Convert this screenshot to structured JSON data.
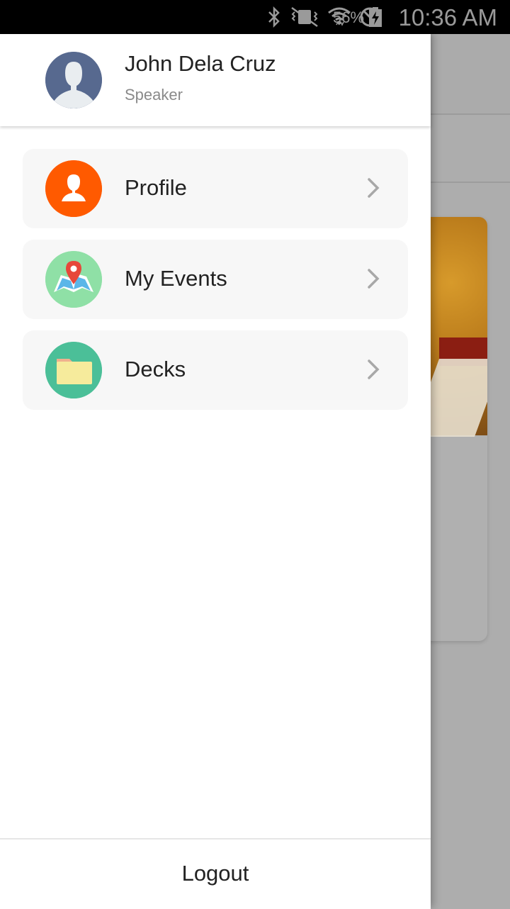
{
  "status_bar": {
    "battery_percent": "56%",
    "time": "10:36 AM",
    "icons": [
      "bluetooth-icon",
      "vibrate-icon",
      "wifi-icon",
      "do-not-disturb-icon",
      "battery-charging-icon"
    ]
  },
  "drawer": {
    "user": {
      "name": "John Dela Cruz",
      "role": "Speaker"
    },
    "items": [
      {
        "label": "Profile",
        "icon": "person-icon",
        "icon_bg": "#FF5A00"
      },
      {
        "label": "My Events",
        "icon": "map-pin-icon",
        "icon_bg": "#8FE0A6"
      },
      {
        "label": "Decks",
        "icon": "folder-icon",
        "icon_bg": "#4BBF98"
      }
    ],
    "logout_label": "Logout"
  },
  "colors": {
    "overlay": "#ADADAD",
    "item_background": "#F7F7F7",
    "avatar_bg": "#57698F"
  }
}
